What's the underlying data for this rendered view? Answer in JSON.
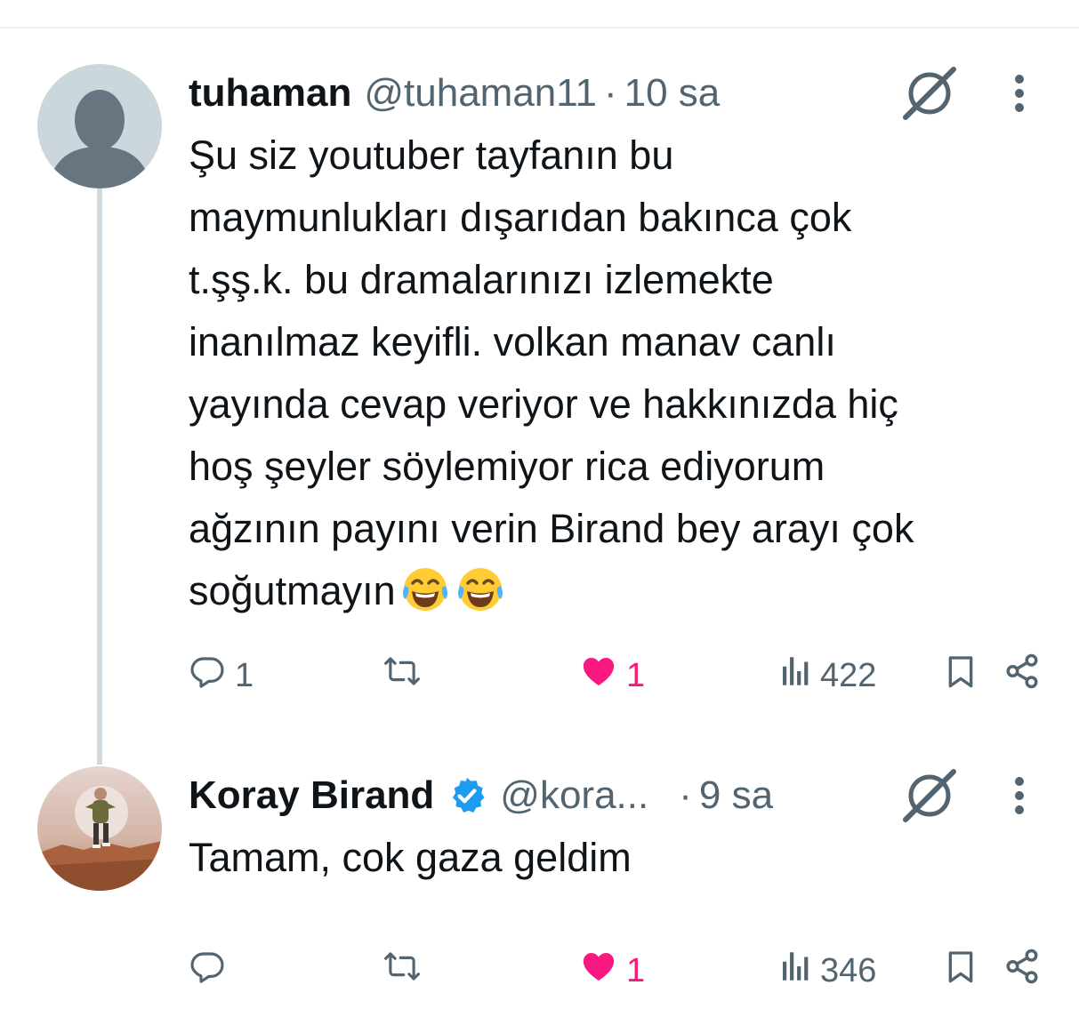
{
  "replies": [
    {
      "name": "tuhaman",
      "handle": "@tuhaman11",
      "separator": "·",
      "time": "10 sa",
      "verified": false,
      "text": "Şu siz youtuber tayfanın bu\nmaymunlukları dışarıdan bakınca çok\nt.şş.k. bu dramalarınızı izlemekte\ninanılmaz keyifli. volkan manav canlı\nyayında cevap veriyor ve hakkınızda hiç\nhoş şeyler söylemiyor rica ediyorum\nağzının payını verin Birand bey arayı çok\nsoğutmayın",
      "trailing_emoji": [
        "tears-of-joy-emoji",
        "tears-of-joy-emoji"
      ],
      "reply_count": "1",
      "repost_count": "",
      "like_count": "1",
      "liked": true,
      "view_count": "422"
    },
    {
      "name": "Koray Birand",
      "handle": "@kora...",
      "separator": "·",
      "time": "9 sa",
      "verified": true,
      "text": "Tamam, cok gaza geldim",
      "reply_count": "",
      "repost_count": "",
      "like_count": "1",
      "liked": true,
      "view_count": "346"
    }
  ],
  "colors": {
    "text": "#0f1419",
    "secondary": "#536471",
    "like": "#f91880",
    "verified": "#1d9bf0",
    "thread_line": "#cfd9de",
    "default_avatar_bg": "#ccd6dd",
    "default_avatar_fg": "#66757f"
  },
  "icons": [
    "grok-icon",
    "more-icon",
    "reply-icon",
    "repost-icon",
    "heart-icon",
    "views-icon",
    "bookmark-icon",
    "share-icon",
    "verified-badge-icon"
  ]
}
